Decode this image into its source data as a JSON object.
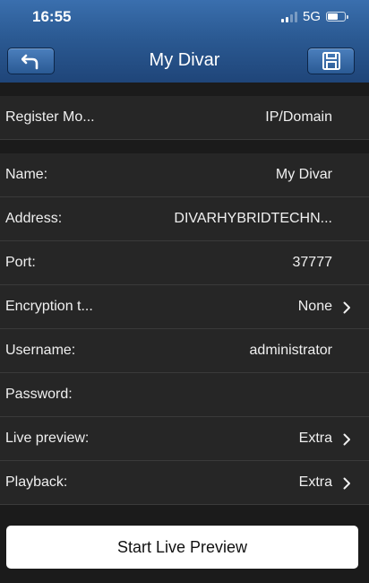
{
  "status_bar": {
    "time": "16:55",
    "network": "5G"
  },
  "nav": {
    "title": "My Divar",
    "back_icon": "back-arrow-icon",
    "save_icon": "floppy-disk-icon"
  },
  "section1": {
    "register_mode": {
      "label": "Register Mo...",
      "value": "IP/Domain"
    }
  },
  "section2": {
    "rows": [
      {
        "label": "Name:",
        "value": "My Divar"
      },
      {
        "label": "Address:",
        "value": "DIVARHYBRIDTECHN..."
      },
      {
        "label": "Port:",
        "value": "37777"
      },
      {
        "label": "Encryption t...",
        "value": "None"
      },
      {
        "label": "Username:",
        "value": "administrator"
      },
      {
        "label": "Password:",
        "value": ""
      },
      {
        "label": "Live preview:",
        "value": "Extra"
      },
      {
        "label": "Playback:",
        "value": "Extra"
      }
    ]
  },
  "actions": {
    "start_live_preview": "Start Live Preview"
  },
  "colors": {
    "header_top": "#3a6fae",
    "header_bottom": "#1f4579",
    "background": "#1b1b1b",
    "row": "#262626",
    "button": "#ffffff"
  }
}
